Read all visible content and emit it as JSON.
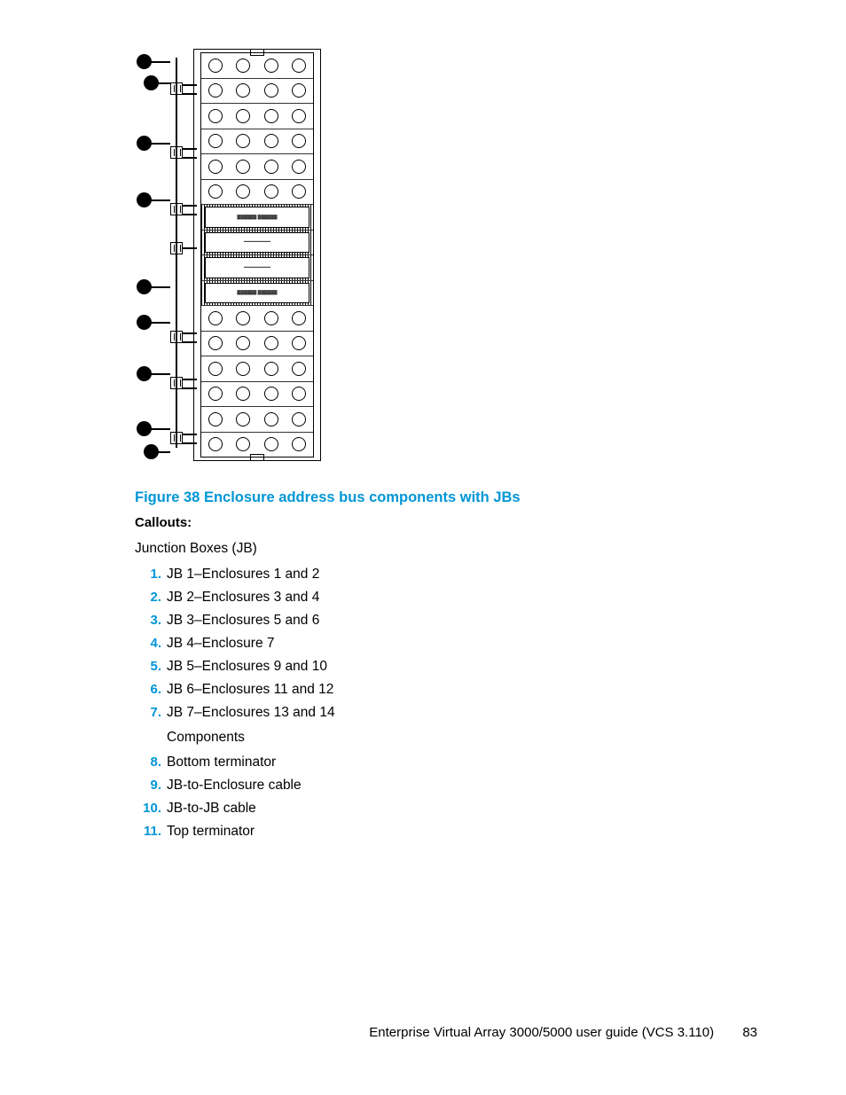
{
  "figure": {
    "caption": "Figure 38 Enclosure address bus components with JBs",
    "callouts_label": "Callouts:",
    "jb_intro": "Junction Boxes (JB)",
    "items": [
      {
        "num": "1.",
        "text": "JB 1–Enclosures 1 and 2"
      },
      {
        "num": "2.",
        "text": "JB 2–Enclosures 3 and 4"
      },
      {
        "num": "3.",
        "text": "JB 3–Enclosures 5 and 6"
      },
      {
        "num": "4.",
        "text": "JB 4–Enclosure 7"
      },
      {
        "num": "5.",
        "text": "JB 5–Enclosures 9 and 10"
      },
      {
        "num": "6.",
        "text": "JB 6–Enclosures 11 and 12"
      },
      {
        "num": "7.",
        "text": "JB 7–Enclosures 13 and 14"
      }
    ],
    "components_label": "Components",
    "components": [
      {
        "num": "8.",
        "text": "Bottom terminator"
      },
      {
        "num": "9.",
        "text": "JB-to-Enclosure cable"
      },
      {
        "num": "10.",
        "text": "JB-to-JB cable"
      },
      {
        "num": "11.",
        "text": "Top terminator"
      }
    ]
  },
  "footer": {
    "text": "Enterprise Virtual Array 3000/5000 user guide (VCS 3.110)",
    "page": "83"
  }
}
